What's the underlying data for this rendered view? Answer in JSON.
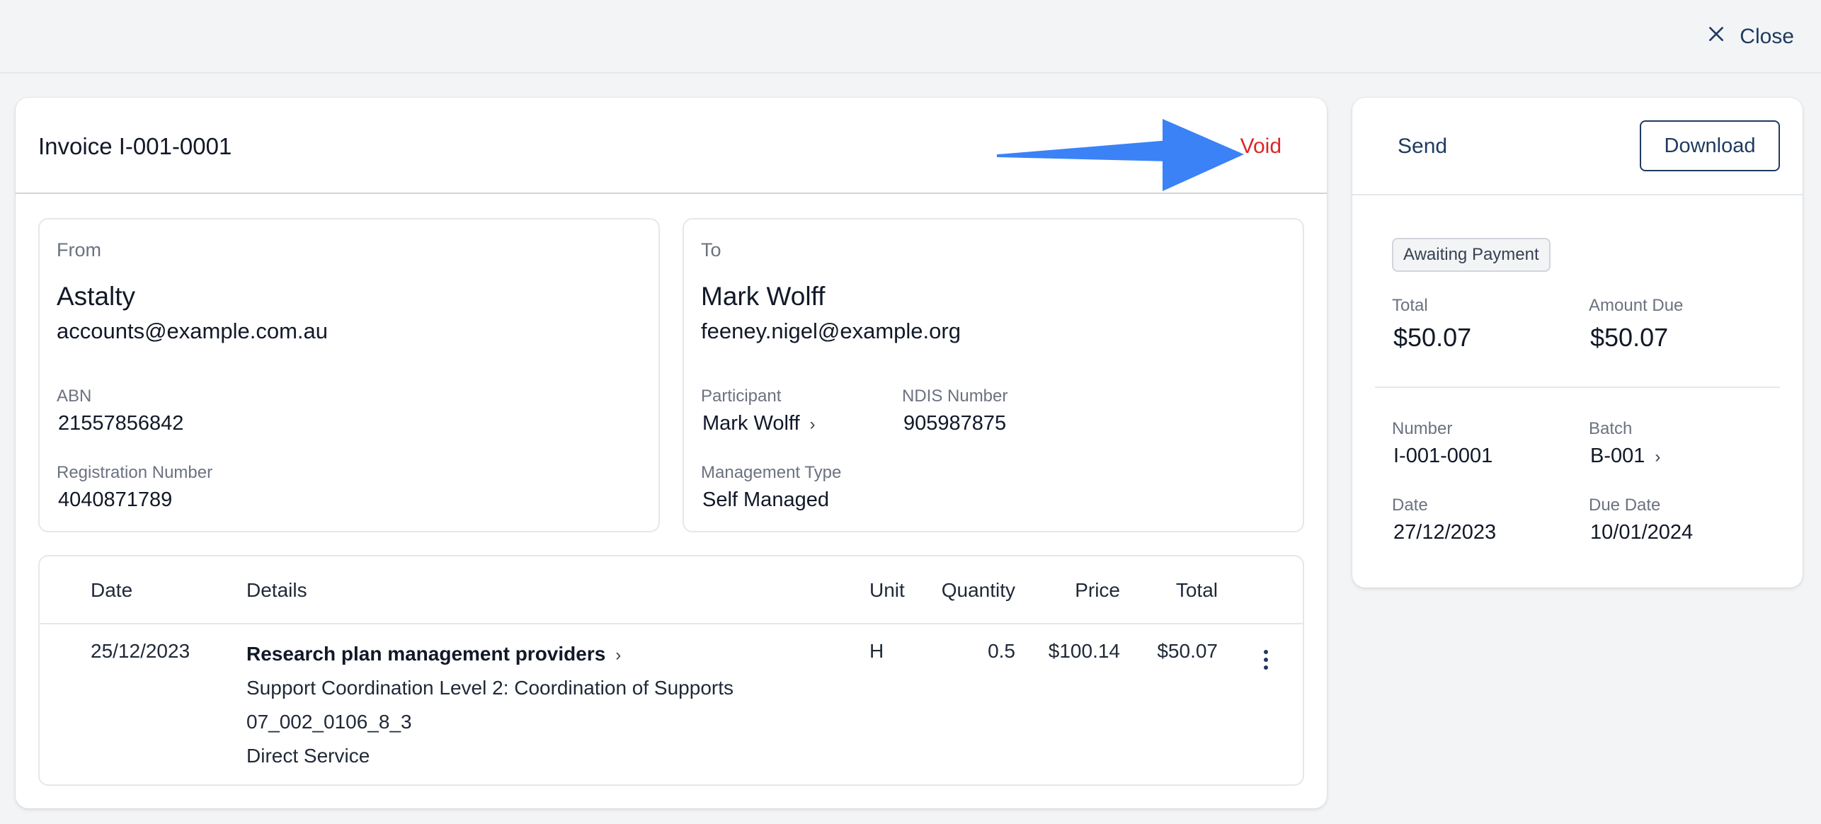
{
  "topbar": {
    "close_label": "Close",
    "close_icon": "close-icon"
  },
  "invoice": {
    "title": "Invoice I-001-0001",
    "void_label": "Void",
    "from": {
      "label": "From",
      "name": "Astalty",
      "email": "accounts@example.com.au",
      "abn_label": "ABN",
      "abn": "21557856842",
      "reg_label": "Registration Number",
      "reg": "4040871789"
    },
    "to": {
      "label": "To",
      "name": "Mark Wolff",
      "email": "feeney.nigel@example.org",
      "participant_label": "Participant",
      "participant": "Mark Wolff",
      "ndis_label": "NDIS Number",
      "ndis": "905987875",
      "mgmt_label": "Management Type",
      "mgmt": "Self Managed"
    },
    "table": {
      "headers": {
        "date": "Date",
        "details": "Details",
        "unit": "Unit",
        "quantity": "Quantity",
        "price": "Price",
        "total": "Total"
      },
      "rows": [
        {
          "date": "25/12/2023",
          "title": "Research plan management providers",
          "line1": "Support Coordination Level 2: Coordination of Supports",
          "line2": "07_002_0106_8_3",
          "line3": "Direct Service",
          "unit": "H",
          "quantity": "0.5",
          "price": "$100.14",
          "total": "$50.07"
        }
      ]
    }
  },
  "sidebar": {
    "send_label": "Send",
    "download_label": "Download",
    "status": "Awaiting Payment",
    "total_label": "Total",
    "total": "$50.07",
    "amount_due_label": "Amount Due",
    "amount_due": "$50.07",
    "number_label": "Number",
    "number": "I-001-0001",
    "batch_label": "Batch",
    "batch": "B-001",
    "date_label": "Date",
    "date": "27/12/2023",
    "due_label": "Due Date",
    "due": "10/01/2024"
  },
  "colors": {
    "accent": "#1e3a5f",
    "danger": "#dc2626",
    "arrow": "#3b82f6"
  }
}
